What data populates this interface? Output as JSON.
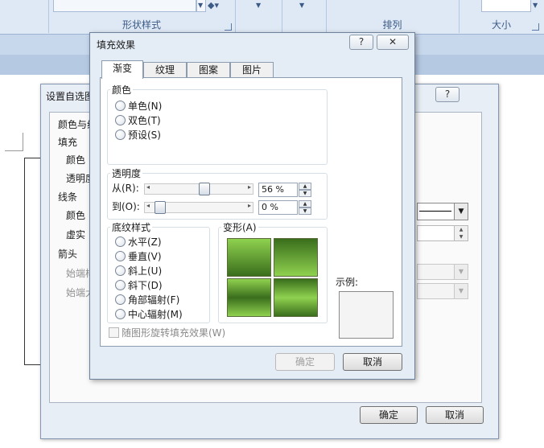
{
  "ribbon": {
    "group_shape_styles": "形状样式",
    "group_arrange": "排列",
    "group_size": "大小"
  },
  "back_dialog": {
    "title": "设置自选图",
    "help": "?",
    "sections": {
      "colors_lines": "颜色与线",
      "fill": "填充",
      "fill_color": "颜色",
      "fill_transparency": "透明度",
      "line": "线条",
      "line_color": "颜色",
      "dashed": "虚实",
      "arrows": "箭头",
      "begin_style": "始端样",
      "begin_size": "始端大"
    },
    "ok": "确定",
    "cancel": "取消"
  },
  "dialog": {
    "title": "填充效果",
    "help": "?",
    "close": "✕",
    "tabs": [
      "渐变",
      "纹理",
      "图案",
      "图片"
    ],
    "colors": {
      "title": "颜色",
      "options": [
        "单色(N)",
        "双色(T)",
        "预设(S)"
      ]
    },
    "transparency": {
      "title": "透明度",
      "from_label": "从(R):",
      "to_label": "到(O):",
      "from_value": "56 %",
      "to_value": "0 %",
      "from_fraction": 0.56,
      "to_fraction": 0.0
    },
    "shading": {
      "title": "底纹样式",
      "options": [
        "水平(Z)",
        "垂直(V)",
        "斜上(U)",
        "斜下(D)",
        "角部辐射(F)",
        "中心辐射(M)"
      ]
    },
    "variants": {
      "title": "变形(A)"
    },
    "sample_label": "示例:",
    "rotate_checkbox": "随图形旋转填充效果(W)",
    "ok": "确定",
    "cancel": "取消"
  },
  "colors": {
    "green_light": "#8fd14f",
    "green_dark": "#3a6e1c",
    "dialog_bg": "#e4ecf6"
  }
}
